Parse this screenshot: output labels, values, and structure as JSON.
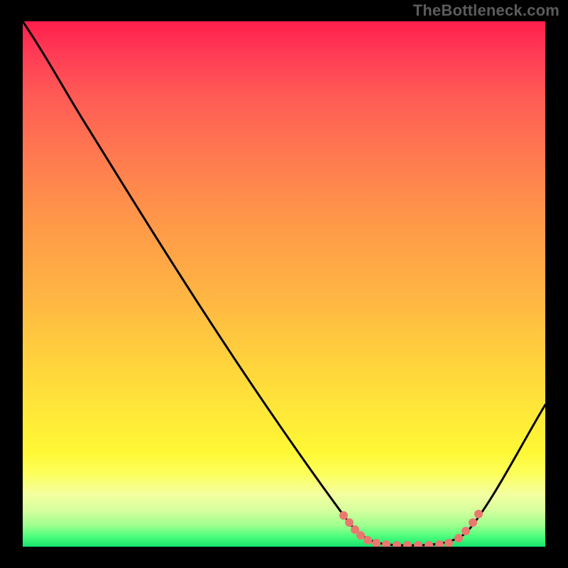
{
  "watermark": "TheBottleneck.com",
  "colors": {
    "background": "#000000",
    "curve": "#000000",
    "dots": "#e9786f",
    "gradient_top": "#ff1e4c",
    "gradient_bottom": "#14e26d",
    "watermark": "#5c5c5c"
  },
  "chart_data": {
    "type": "line",
    "title": "",
    "xlabel": "",
    "ylabel": "",
    "xlim": [
      0,
      100
    ],
    "ylim": [
      0,
      100
    ],
    "note": "Axes unlabeled in source; x and y treated as 0–100 percent of plot area. y=100 at top (red / high bottleneck), y=0 at bottom (green / optimal). Curve depicts bottleneck severity vs. an implicit x variable; valley near x≈72 marks best-fit region.",
    "series": [
      {
        "name": "bottleneck-curve",
        "x": [
          0,
          5,
          10,
          15,
          20,
          25,
          30,
          35,
          40,
          45,
          50,
          55,
          60,
          62,
          65,
          68,
          72,
          76,
          80,
          82,
          85,
          88,
          92,
          96,
          100
        ],
        "y": [
          100,
          93,
          86,
          80,
          73,
          66,
          58,
          51,
          43,
          36,
          28,
          20,
          12,
          8,
          5,
          2,
          1,
          1,
          1,
          2,
          4,
          8,
          14,
          21,
          27
        ]
      },
      {
        "name": "valley-marker-dots",
        "x": [
          61,
          62,
          63,
          64,
          65,
          67,
          69,
          71,
          73,
          75,
          77,
          79,
          81,
          83,
          85,
          86,
          87
        ],
        "y": [
          6,
          5,
          4,
          3,
          2,
          1.5,
          1,
          1,
          1,
          1,
          1,
          1,
          1.3,
          2,
          3,
          4,
          6
        ]
      }
    ],
    "grid": false,
    "legend": false
  }
}
